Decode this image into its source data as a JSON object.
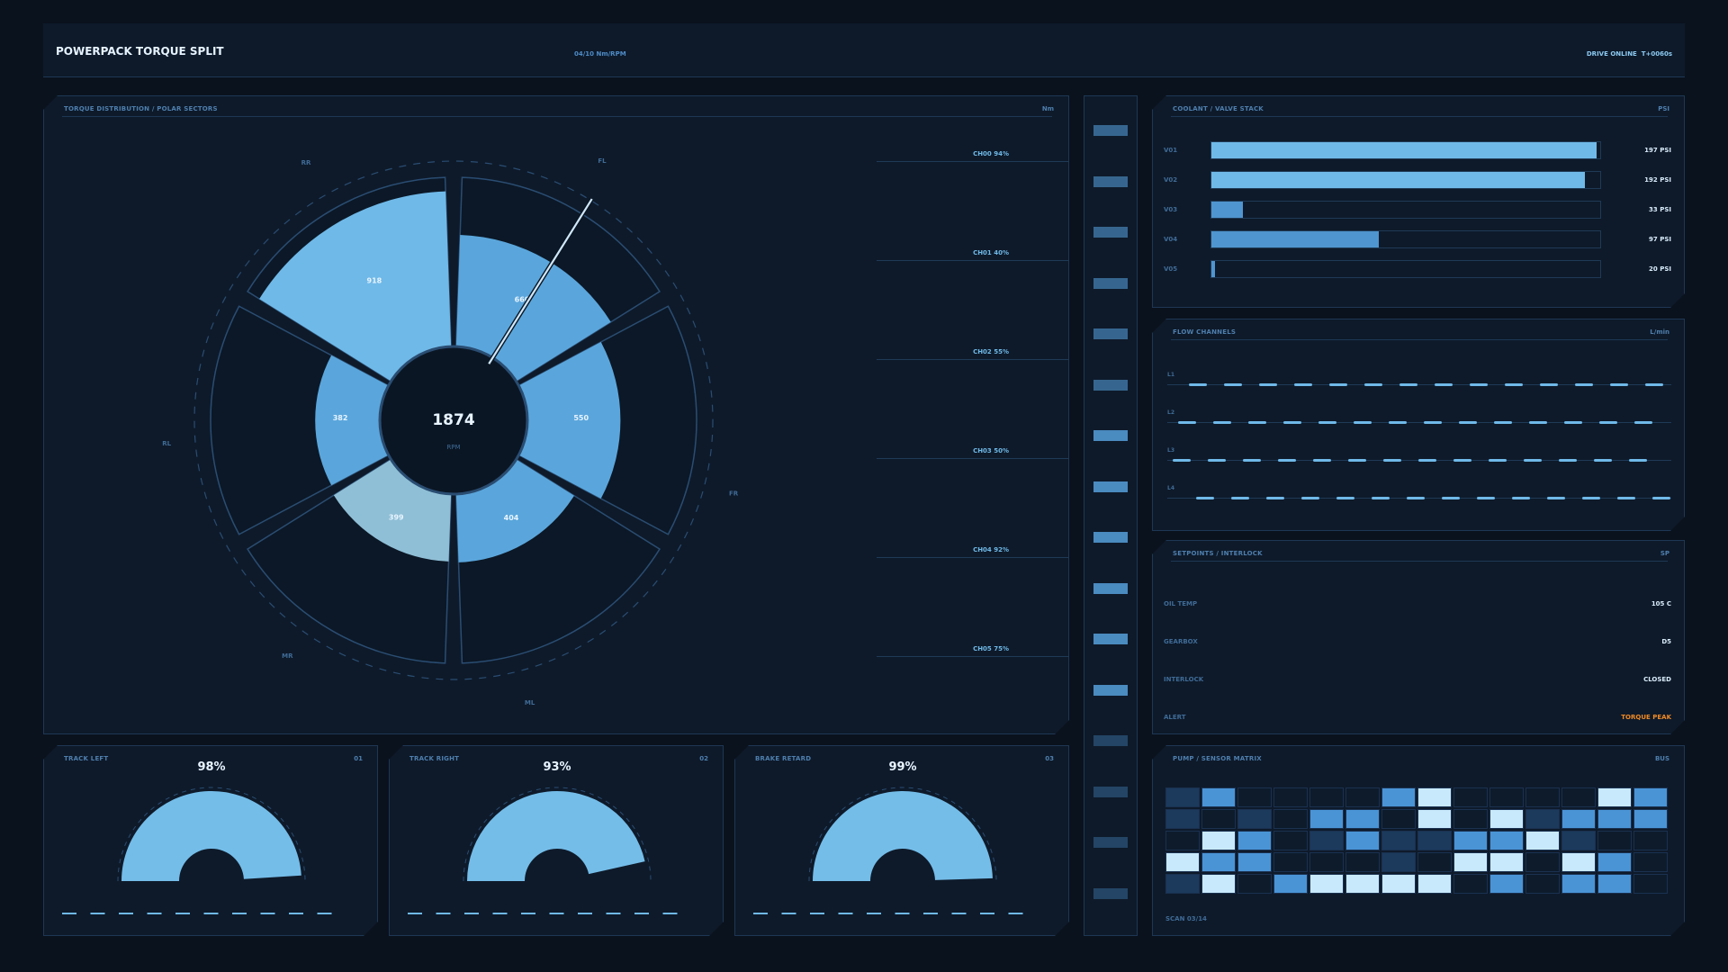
{
  "header": {
    "title": "POWERPACK TORQUE SPLIT",
    "center": "04/10 Nm/RPM",
    "status": "DRIVE ONLINE  T+0060s"
  },
  "polar": {
    "title": "TORQUE DISTRIBUTION / POLAR SECTORS",
    "tag": "Nm",
    "center_value": "1874",
    "center_unit": "RPM",
    "axis_labels": [
      "RR",
      "FL",
      "RL",
      "FR",
      "MR",
      "ML"
    ],
    "sectors": [
      {
        "label": "660",
        "value": 660,
        "color": "#5aa6dc"
      },
      {
        "label": "550",
        "value": 550,
        "color": "#5aa6dc"
      },
      {
        "label": "404",
        "value": 404,
        "color": "#5aa6dc"
      },
      {
        "label": "399",
        "value": 399,
        "color": "#8fbfd6"
      },
      {
        "label": "382",
        "value": 382,
        "color": "#5aa6dc"
      },
      {
        "label": "918",
        "value": 918,
        "color": "#6fb9e8"
      }
    ],
    "channels": [
      "CH00 94%",
      "CH01 40%",
      "CH02 55%",
      "CH03 50%",
      "CH04 92%",
      "CH05 75%"
    ]
  },
  "coolant": {
    "title": "COOLANT / VALVE STACK",
    "tag": "PSI",
    "rows": [
      {
        "label": "V01",
        "value": "197 PSI",
        "fill": 0.99,
        "color": "#6fb9e8"
      },
      {
        "label": "V02",
        "value": "192 PSI",
        "fill": 0.96,
        "color": "#6fb9e8"
      },
      {
        "label": "V03",
        "value": "33 PSI",
        "fill": 0.08,
        "color": "#4f95cf"
      },
      {
        "label": "V04",
        "value": "97 PSI",
        "fill": 0.43,
        "color": "#4f95cf"
      },
      {
        "label": "V05",
        "value": "20 PSI",
        "fill": 0.01,
        "color": "#4f95cf"
      }
    ]
  },
  "flow": {
    "title": "FLOW CHANNELS",
    "tag": "L/min",
    "lines": [
      "L1",
      "L2",
      "L3",
      "L4"
    ]
  },
  "setpoints": {
    "title": "SETPOINTS / INTERLOCK",
    "tag": "SP",
    "rows": [
      {
        "label": "OIL TEMP",
        "value": "105 C",
        "color": "#d9ecfb"
      },
      {
        "label": "GEARBOX",
        "value": "D5",
        "color": "#d9ecfb"
      },
      {
        "label": "INTERLOCK",
        "value": "CLOSED",
        "color": "#d9ecfb"
      },
      {
        "label": "ALERT",
        "value": "TORQUE PEAK",
        "color": "#f08a24"
      }
    ]
  },
  "matrix": {
    "title": "PUMP / SENSOR MATRIX",
    "tag": "BUS",
    "footer": "SCAN 03/14",
    "levels": [
      [
        1,
        3,
        0,
        0,
        0,
        0,
        3,
        5,
        0,
        0,
        0,
        0,
        5,
        3
      ],
      [
        1,
        0,
        1,
        0,
        3,
        3,
        0,
        5,
        0,
        5,
        1,
        3,
        3,
        3
      ],
      [
        0,
        5,
        3,
        0,
        1,
        3,
        1,
        1,
        3,
        3,
        5,
        1,
        0,
        0
      ],
      [
        5,
        3,
        3,
        0,
        0,
        0,
        1,
        0,
        5,
        5,
        0,
        5,
        3,
        0
      ],
      [
        1,
        5,
        0,
        3,
        5,
        5,
        5,
        5,
        0,
        3,
        0,
        3,
        3,
        0
      ]
    ]
  },
  "gauges": [
    {
      "title": "TRACK LEFT",
      "tag": "01",
      "value": "98%",
      "fraction": 0.98
    },
    {
      "title": "TRACK RIGHT",
      "tag": "02",
      "value": "93%",
      "fraction": 0.93
    },
    {
      "title": "BRAKE RETARD",
      "tag": "03",
      "value": "99%",
      "fraction": 0.99
    }
  ],
  "colors": {
    "accent": "#6fb9e8",
    "alert": "#f08a24",
    "panel": "#0e1a2a",
    "border": "#1e3754"
  }
}
